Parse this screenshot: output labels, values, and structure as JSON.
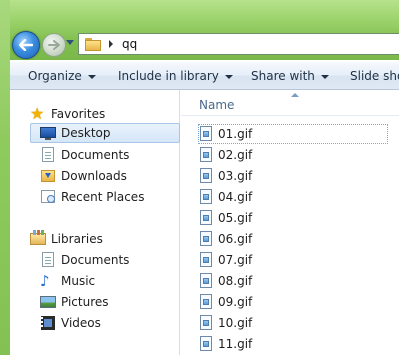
{
  "window": {
    "address": {
      "crumbs": [
        "qq"
      ]
    }
  },
  "commandbar": {
    "items": [
      {
        "label": "Organize"
      },
      {
        "label": "Include in library"
      },
      {
        "label": "Share with"
      },
      {
        "label": "Slide show"
      }
    ]
  },
  "nav": {
    "favorites": {
      "label": "Favorites",
      "items": [
        {
          "label": "Desktop",
          "icon": "desktop-icon",
          "selected": true
        },
        {
          "label": "Documents",
          "icon": "document-icon"
        },
        {
          "label": "Downloads",
          "icon": "downloads-folder-icon"
        },
        {
          "label": "Recent Places",
          "icon": "recent-places-icon"
        }
      ]
    },
    "libraries": {
      "label": "Libraries",
      "items": [
        {
          "label": "Documents",
          "icon": "document-icon"
        },
        {
          "label": "Music",
          "icon": "music-note-icon"
        },
        {
          "label": "Pictures",
          "icon": "pictures-icon"
        },
        {
          "label": "Videos",
          "icon": "video-film-icon"
        }
      ]
    }
  },
  "filelist": {
    "column_name": "Name",
    "files": [
      "01.gif",
      "02.gif",
      "03.gif",
      "04.gif",
      "05.gif",
      "06.gif",
      "07.gif",
      "08.gif",
      "09.gif",
      "10.gif",
      "11.gif"
    ]
  }
}
